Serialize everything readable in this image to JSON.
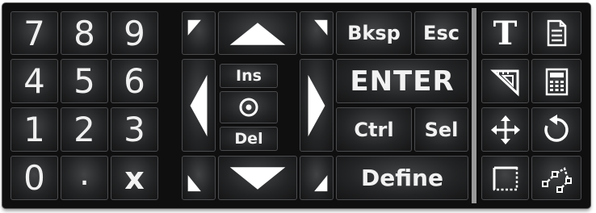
{
  "numpad": {
    "row1": [
      "7",
      "8",
      "9"
    ],
    "row2": [
      "4",
      "5",
      "6"
    ],
    "row3": [
      "1",
      "2",
      "3"
    ],
    "row4": [
      "0",
      ".",
      "x"
    ]
  },
  "nav": {
    "ins_label": "Ins",
    "del_label": "Del"
  },
  "keys": {
    "bksp_label": "Bksp",
    "esc_label": "Esc",
    "enter_label": "ENTER",
    "ctrl_label": "Ctrl",
    "sel_label": "Sel",
    "define_label": "Define"
  },
  "tools": {
    "text_tool_label": "T",
    "icons": [
      "text-tool-icon",
      "document-icon",
      "triangle-ruler-icon",
      "calculator-icon",
      "move-arrows-icon",
      "rotate-icon",
      "dashed-rectangle-icon",
      "polyline-nodes-icon"
    ]
  },
  "colors": {
    "panel_background": "#0f0f10",
    "key_face": "#2a2b2c",
    "text": "#f2f2f2",
    "separator": "#9a9a9a"
  }
}
